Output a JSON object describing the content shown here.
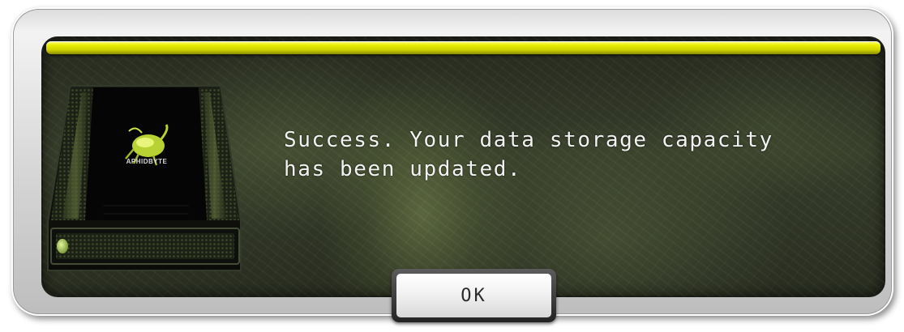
{
  "dialog": {
    "message": "Success. Your data storage capacity\nhas been updated.",
    "ok_label": "OK"
  },
  "drive": {
    "brand": "APHIDBYTE",
    "icon": "hard-drive-icon"
  },
  "colors": {
    "title_bar": "#e9f000",
    "panel_background": "#2f3526",
    "text": "#f2f2f2",
    "status_led": "#a9c35a"
  }
}
